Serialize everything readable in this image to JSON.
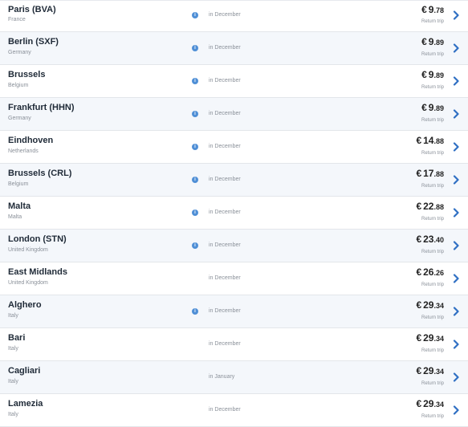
{
  "currency": "€",
  "return_label": "Return trip",
  "destinations": [
    {
      "city": "Paris (BVA)",
      "country": "France",
      "info": true,
      "when": "in December",
      "whole": "9",
      "dec": ".78"
    },
    {
      "city": "Berlin (SXF)",
      "country": "Germany",
      "info": true,
      "when": "in December",
      "whole": "9",
      "dec": ".89"
    },
    {
      "city": "Brussels",
      "country": "Belgium",
      "info": true,
      "when": "in December",
      "whole": "9",
      "dec": ".89"
    },
    {
      "city": "Frankfurt (HHN)",
      "country": "Germany",
      "info": true,
      "when": "in December",
      "whole": "9",
      "dec": ".89"
    },
    {
      "city": "Eindhoven",
      "country": "Netherlands",
      "info": true,
      "when": "in December",
      "whole": "14",
      "dec": ".88"
    },
    {
      "city": "Brussels (CRL)",
      "country": "Belgium",
      "info": true,
      "when": "in December",
      "whole": "17",
      "dec": ".88"
    },
    {
      "city": "Malta",
      "country": "Malta",
      "info": true,
      "when": "in December",
      "whole": "22",
      "dec": ".88"
    },
    {
      "city": "London (STN)",
      "country": "United Kingdom",
      "info": true,
      "when": "in December",
      "whole": "23",
      "dec": ".40"
    },
    {
      "city": "East Midlands",
      "country": "United Kingdom",
      "info": false,
      "when": "in December",
      "whole": "26",
      "dec": ".26"
    },
    {
      "city": "Alghero",
      "country": "Italy",
      "info": true,
      "when": "in December",
      "whole": "29",
      "dec": ".34"
    },
    {
      "city": "Bari",
      "country": "Italy",
      "info": false,
      "when": "in December",
      "whole": "29",
      "dec": ".34"
    },
    {
      "city": "Cagliari",
      "country": "Italy",
      "info": false,
      "when": "in January",
      "whole": "29",
      "dec": ".34"
    },
    {
      "city": "Lamezia",
      "country": "Italy",
      "info": false,
      "when": "in December",
      "whole": "29",
      "dec": ".34"
    }
  ]
}
